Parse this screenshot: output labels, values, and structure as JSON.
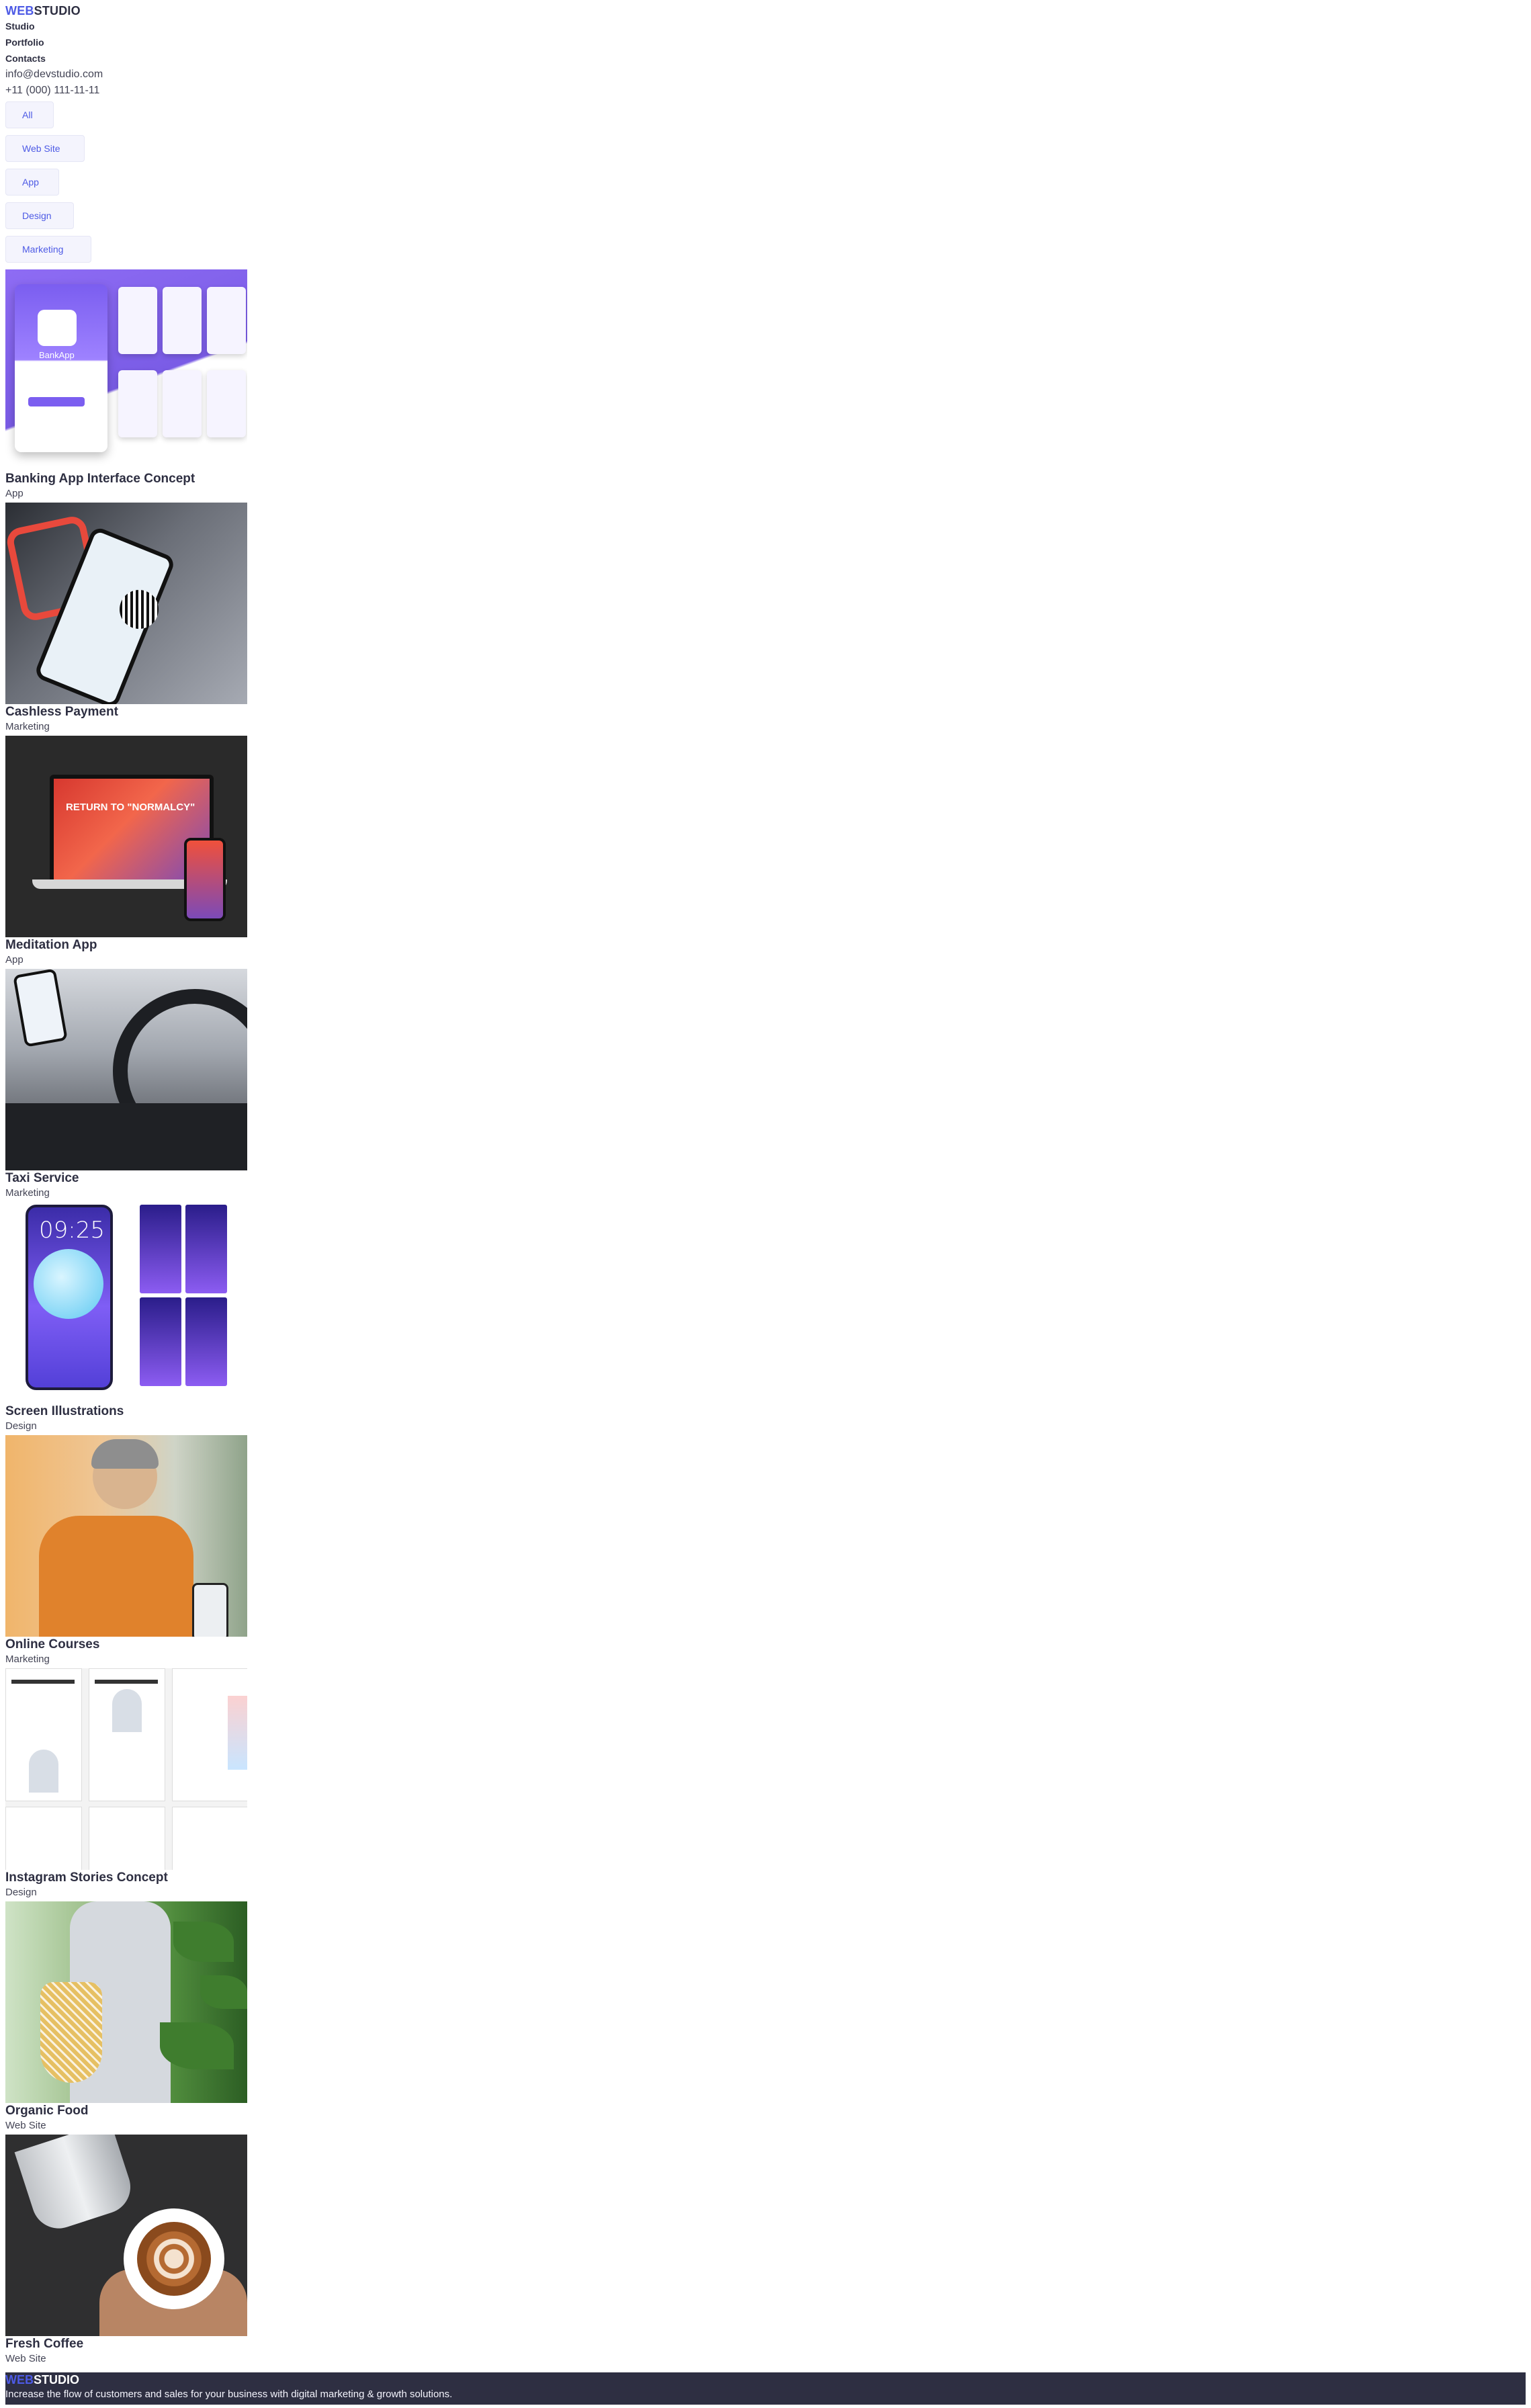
{
  "header": {
    "logo_accent": "WEB",
    "logo_rest": "STUDIO",
    "nav": [
      "Studio",
      "Portfolio",
      "Contacts"
    ],
    "email": "info@devstudio.com",
    "phone": "+11 (000) 111-11-11"
  },
  "filters": [
    "All",
    "Web Site",
    "App",
    "Design",
    "Marketing"
  ],
  "portfolio": [
    {
      "title": "Banking App Interface Concept",
      "category": "App",
      "image": "banking-app-screens"
    },
    {
      "title": "Cashless Payment",
      "category": "Marketing",
      "image": "phone-qr-payment"
    },
    {
      "title": "Meditation App",
      "category": "App",
      "image": "laptop-and-phone-mockup"
    },
    {
      "title": "Taxi Service",
      "category": "Marketing",
      "image": "car-interior-phone"
    },
    {
      "title": "Screen Illustrations",
      "category": "Design",
      "image": "moon-illustration-screens"
    },
    {
      "title": "Online Courses",
      "category": "Marketing",
      "image": "woman-with-phone"
    },
    {
      "title": "Instagram Stories Concept",
      "category": "Design",
      "image": "instagram-stories-panels"
    },
    {
      "title": "Organic Food",
      "category": "Web Site",
      "image": "mesh-bag-vegetables"
    },
    {
      "title": "Fresh Coffee",
      "category": "Web Site",
      "image": "latte-art-pour"
    }
  ],
  "thumb_text": {
    "bank_label": "BankApp",
    "med_label": "RETURN TO \"NORMALCY\"",
    "screen_clock": "09:25"
  },
  "footer": {
    "logo_accent": "WEB",
    "logo_rest": "STUDIO",
    "tagline": "Increase the flow of customers and sales for your business with digital marketing & growth solutions."
  },
  "colors": {
    "accent": "#4d5ae5",
    "dark": "#2e2f42",
    "filter_bg": "#f4f4fd",
    "footer_bg": "#2e2f42"
  }
}
